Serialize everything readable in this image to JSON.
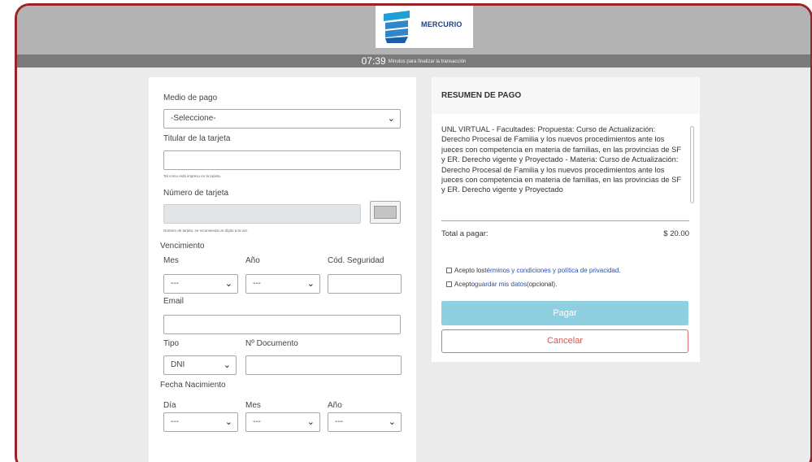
{
  "header": {
    "brand": "MERCURIO",
    "timer": "07:39",
    "timer_caption": "Minutos para finalizar la transacción"
  },
  "form": {
    "payment_method_label": "Medio de pago",
    "payment_method_value": "-Seleccione-",
    "cardholder_label": "Titular de la tarjeta",
    "cardholder_hint": "Tal como está impreso en la tarjeta.",
    "card_number_label": "Número de tarjeta",
    "card_number_hint": "Número de tarjeta, se recomienda un dígito a la vez.",
    "expiry_label": "Vencimiento",
    "month_label": "Mes",
    "year_label": "Año",
    "security_code_label": "Cód. Seguridad",
    "month_value": "---",
    "year_value": "---",
    "email_label": "Email",
    "doc_type_label": "Tipo",
    "doc_type_value": "DNI",
    "doc_number_label": "Nº Documento",
    "birth_date_label": "Fecha Nacimiento",
    "birth_day_label": "Día",
    "birth_month_label": "Mes",
    "birth_year_label": "Año",
    "birth_day_value": "---",
    "birth_month_value": "---",
    "birth_year_value": "---"
  },
  "summary": {
    "title": "RESUMEN DE PAGO",
    "description": "UNL VIRTUAL - Facultades: Propuesta: Curso de Actualización: Derecho Procesal de Familia y los nuevos procedimientos ante los jueces con competencia en materia de familias, en las provincias de SF y ER. Derecho vigente y Proyectado - Materia: Curso de Actualización: Derecho Procesal de Familia y los nuevos procedimientos ante los jueces con competencia en materia de familias, en las provincias de SF y ER. Derecho vigente y Proyectado",
    "total_label": "Total a pagar:",
    "total_value": "$ 20.00",
    "terms_prefix": "Acepto los ",
    "terms_link": "términos y condiciones y política de privacidad",
    "terms_suffix": ".",
    "save_prefix": "Acepto ",
    "save_link": "guardar mis datos",
    "save_suffix": " (opcional).",
    "pay_label": "Pagar",
    "cancel_label": "Cancelar"
  },
  "colors": {
    "frame_border": "#9b2226",
    "pay_button": "#8fd0e0",
    "cancel_border": "#e06b70",
    "link": "#2b4fa8"
  }
}
